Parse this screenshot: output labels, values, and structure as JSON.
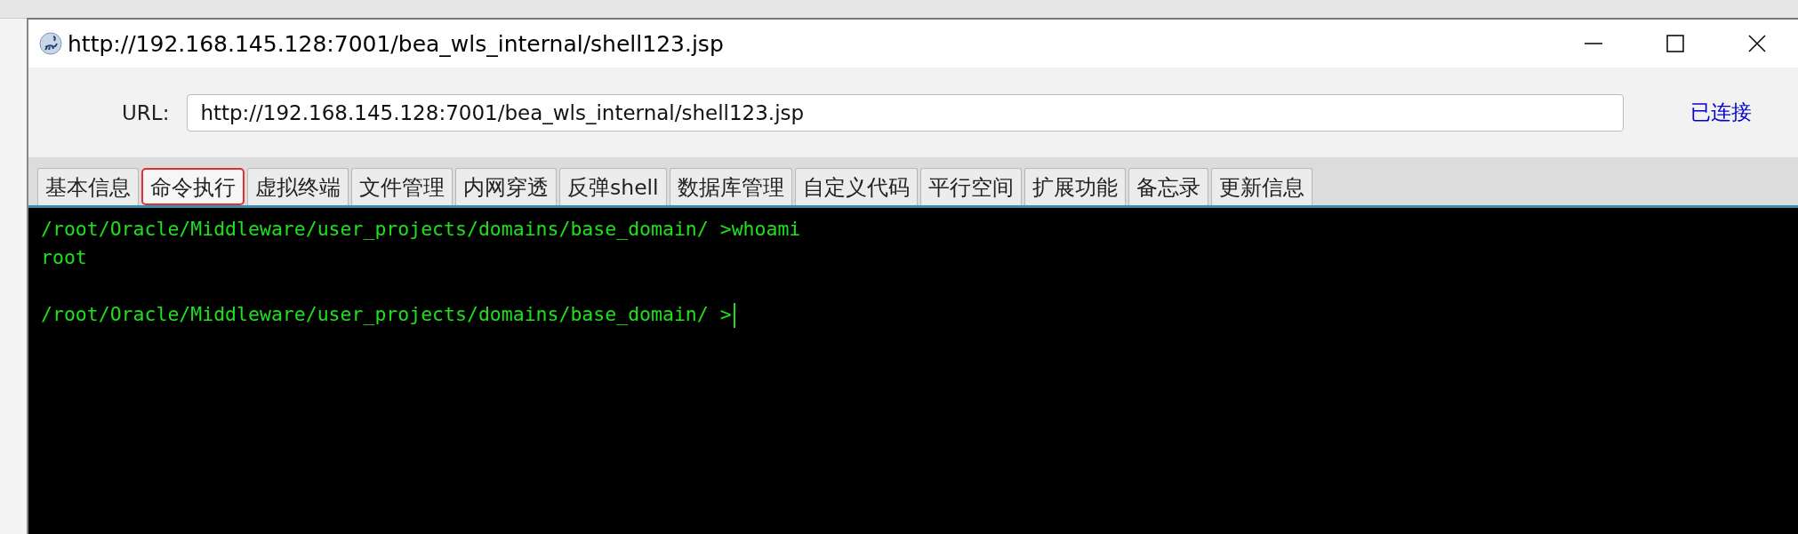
{
  "window": {
    "title": "http://192.168.145.128:7001/bea_wls_internal/shell123.jsp"
  },
  "url": {
    "label": "URL:",
    "value": "http://192.168.145.128:7001/bea_wls_internal/shell123.jsp"
  },
  "status": "已连接",
  "tabs": [
    {
      "label": "基本信息",
      "selected": false
    },
    {
      "label": "命令执行",
      "selected": true
    },
    {
      "label": "虚拟终端",
      "selected": false
    },
    {
      "label": "文件管理",
      "selected": false
    },
    {
      "label": "内网穿透",
      "selected": false
    },
    {
      "label": "反弹shell",
      "selected": false
    },
    {
      "label": "数据库管理",
      "selected": false
    },
    {
      "label": "自定义代码",
      "selected": false
    },
    {
      "label": "平行空间",
      "selected": false
    },
    {
      "label": "扩展功能",
      "selected": false
    },
    {
      "label": "备忘录",
      "selected": false
    },
    {
      "label": "更新信息",
      "selected": false
    }
  ],
  "terminal": {
    "entries": [
      {
        "prompt": "/root/Oracle/Middleware/user_projects/domains/base_domain/ >",
        "command": "whoami",
        "output": [
          "root"
        ],
        "cursor": false
      },
      {
        "prompt": "/root/Oracle/Middleware/user_projects/domains/base_domain/ >",
        "cursor": true
      }
    ]
  }
}
